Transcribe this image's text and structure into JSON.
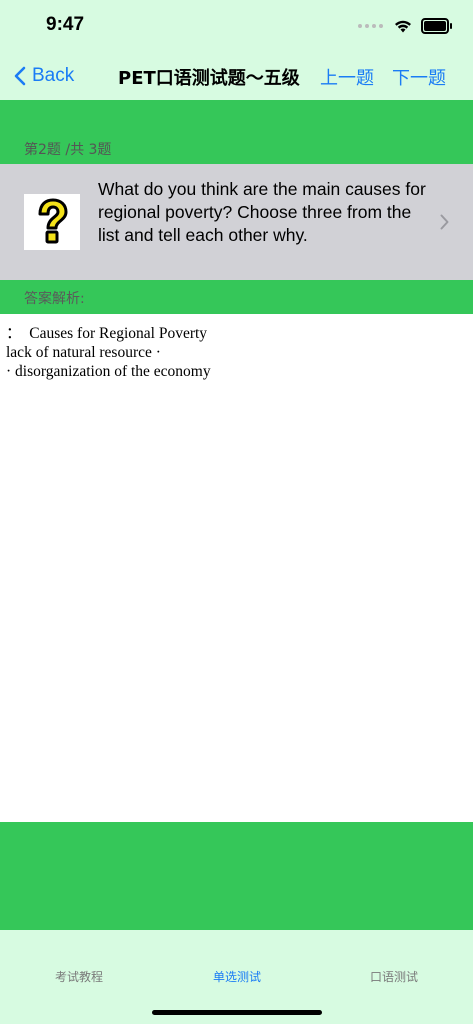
{
  "status_bar": {
    "time": "9:47"
  },
  "nav": {
    "back_label": "Back",
    "title": "PET口语测试题～五级",
    "prev_label": "上一题",
    "next_label": "下一题"
  },
  "question": {
    "counter": "第2题 /共 3题",
    "text": "What do you think are the main causes for regional poverty? Choose three from the list and tell each other why.",
    "image_icon": "question-mark-icon"
  },
  "answer": {
    "label": "答案解析:",
    "lines": [
      "：  Causes for Regional Poverty",
      "lack of natural resource ·",
      "",
      "· disorganization of the economy"
    ]
  },
  "tabs": [
    {
      "label": "考试教程",
      "active": false
    },
    {
      "label": "单选测试",
      "active": true
    },
    {
      "label": "口语测试",
      "active": false
    }
  ],
  "colors": {
    "bar_background": "#d7fbe1",
    "green": "#35c759",
    "accent_blue": "#1a7cf5",
    "question_row_gray": "#d1d1d6"
  }
}
